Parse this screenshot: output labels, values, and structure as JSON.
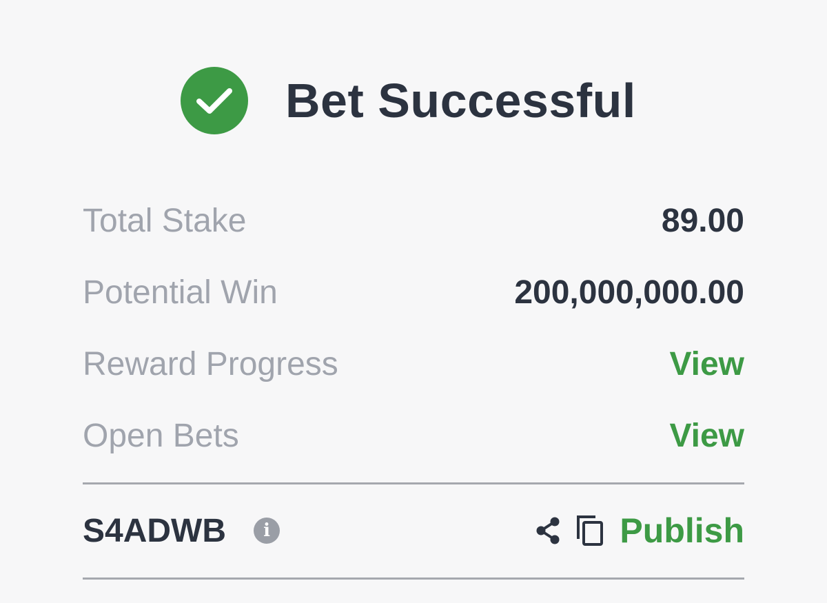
{
  "header": {
    "title": "Bet Successful",
    "icon": "check-circle-icon",
    "accent_color": "#3d9a45"
  },
  "summary": {
    "rows": [
      {
        "label": "Total Stake",
        "value": "89.00"
      },
      {
        "label": "Potential Win",
        "value": "200,000,000.00"
      },
      {
        "label": "Reward Progress",
        "link": "View"
      },
      {
        "label": "Open Bets",
        "link": "View"
      }
    ]
  },
  "footer": {
    "booking_code": "S4ADWB",
    "info_icon": "info-icon",
    "info_glyph": "i",
    "share_icon": "share-icon",
    "copy_icon": "copy-icon",
    "publish_label": "Publish"
  }
}
